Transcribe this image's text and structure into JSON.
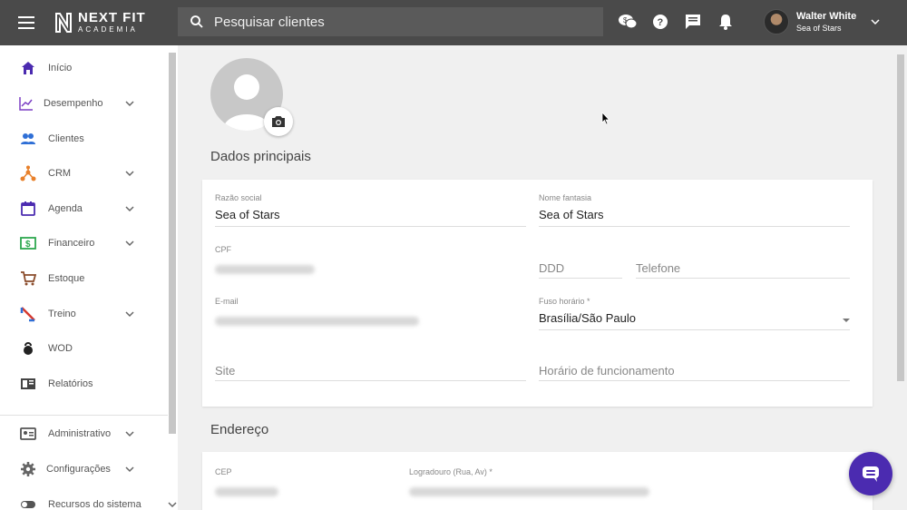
{
  "header": {
    "logo_main": "NEXT FIT",
    "logo_sub": "ACADEMIA",
    "search_placeholder": "Pesquisar clientes",
    "user_name": "Walter White",
    "user_org": "Sea of Stars"
  },
  "sidebar": {
    "items": [
      {
        "label": "Início",
        "icon": "home-icon",
        "color": "#4b2bb0"
      },
      {
        "label": "Desempenho",
        "icon": "chart-line-icon",
        "color": "#7b3fc4"
      },
      {
        "label": "Clientes",
        "icon": "people-icon",
        "color": "#2f6fd6"
      },
      {
        "label": "CRM",
        "icon": "crm-icon",
        "color": "#e8802a"
      },
      {
        "label": "Agenda",
        "icon": "calendar-icon",
        "color": "#4b2bb0"
      },
      {
        "label": "Financeiro",
        "icon": "money-icon",
        "color": "#2ea84f"
      },
      {
        "label": "Estoque",
        "icon": "cart-icon",
        "color": "#8a4b2a"
      },
      {
        "label": "Treino",
        "icon": "treino-icon",
        "color": "#d63a2f"
      },
      {
        "label": "WOD",
        "icon": "kettlebell-icon",
        "color": "#222222"
      },
      {
        "label": "Relatórios",
        "icon": "report-icon",
        "color": "#444444"
      },
      {
        "label": "Administrativo",
        "icon": "id-card-icon",
        "color": "#555555"
      },
      {
        "label": "Configurações",
        "icon": "gear-icon",
        "color": "#666666"
      },
      {
        "label": "Recursos do sistema",
        "icon": "toggle-icon",
        "color": "#555555"
      }
    ]
  },
  "main": {
    "section_main_title": "Dados principais",
    "section_address_title": "Endereço",
    "fields": {
      "razao_label": "Razão social",
      "razao_value": "Sea of Stars",
      "fantasia_label": "Nome fantasia",
      "fantasia_value": "Sea of Stars",
      "cpf_label": "CPF",
      "ddd_placeholder": "DDD",
      "telefone_placeholder": "Telefone",
      "email_label": "E-mail",
      "fuso_label": "Fuso horário *",
      "fuso_value": "Brasília/São Paulo",
      "site_placeholder": "Site",
      "horario_placeholder": "Horário de funcionamento",
      "cep_label": "CEP",
      "logradouro_label": "Logradouro (Rua, Av) *"
    }
  },
  "colors": {
    "topbar": "#4a4a4a",
    "accent": "#4b2bb0"
  }
}
